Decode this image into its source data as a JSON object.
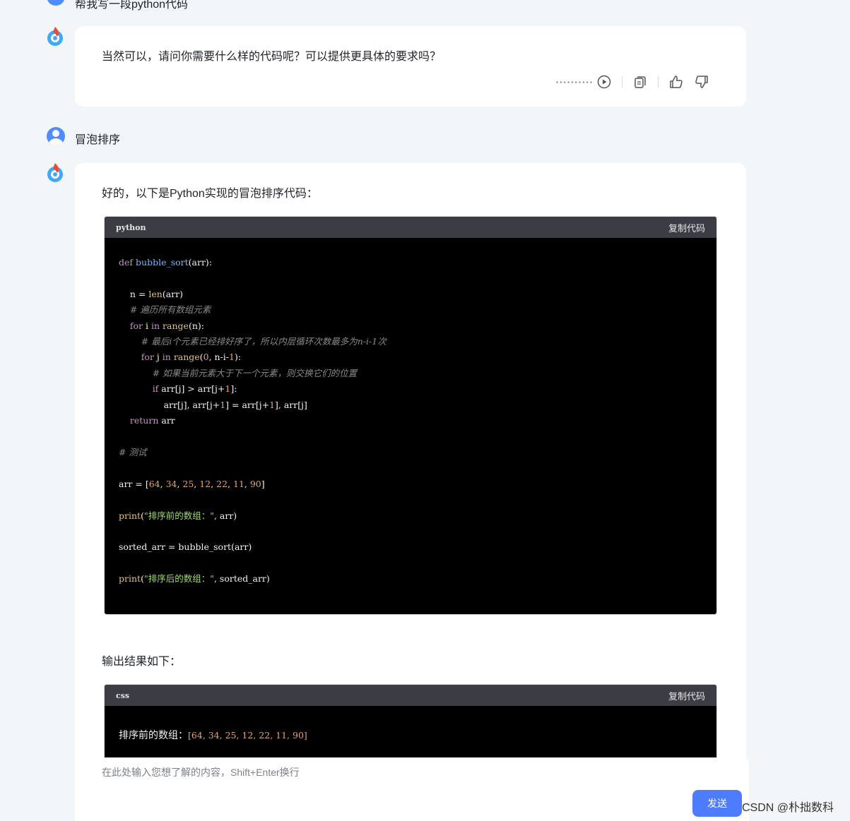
{
  "conversation": {
    "prev_user_message": "帮我写一段python代码",
    "reply1": {
      "text": "当然可以，请问你需要什么样的代码呢？可以提供更具体的要求吗？",
      "dots": "··········"
    },
    "user_message": "冒泡排序",
    "reply2": {
      "intro": "好的，以下是Python实现的冒泡排序代码：",
      "code1": {
        "lang": "python",
        "copy_label": "复制代码"
      },
      "output_intro": "输出结果如下：",
      "code2": {
        "lang": "css",
        "copy_label": "复制代码",
        "line1_text": "排序前的数组：",
        "line1_value": "[64, 34, 25, 12, 22, 11, 90]"
      }
    }
  },
  "code_lines": {
    "def": "def",
    "fname": "bubble_sort",
    "args": "(arr):",
    "n_assign": "n = ",
    "len": "len",
    "len_args": "(arr)",
    "c1": "# 遍历所有数组元素",
    "for1": "for",
    "for1_mid": " i ",
    "in1": "in",
    "range1": "range",
    "range1_args": "(n):",
    "c2": "# 最后i个元素已经排好序了，所以内层循环次数最多为n-i-1次",
    "for2": "for",
    "for2_mid": " j ",
    "in2": "in",
    "range2": "range",
    "range2_open": "(",
    "zero": "0",
    "range2_rest": ", n-i-",
    "one_a": "1",
    "range2_close": "):",
    "c3": "# 如果当前元素大于下一个元素，则交换它们的位置",
    "if": "if",
    "if_a": " arr[j] > arr[j+",
    "one_b": "1",
    "if_b": "]:",
    "swap_a": "arr[j], arr[j+",
    "one_c": "1",
    "swap_b": "] = arr[j+",
    "one_d": "1",
    "swap_c": "], arr[j]",
    "return": "return",
    "return_v": " arr",
    "c4": "# 测试",
    "arr_assign": "arr = [",
    "v1": "64",
    "v2": "34",
    "v3": "25",
    "v4": "12",
    "v5": "22",
    "v6": "11",
    "v7": "90",
    "comma": ", ",
    "arr_close": "]",
    "print1": "print",
    "print1_open": "(",
    "str1": "\"排序前的数组：\"",
    "print1_rest": ", arr)",
    "sorted_line_a": "sorted_arr = ",
    "sorted_fn": "bubble_sort",
    "sorted_line_b": "(arr)",
    "print2": "print",
    "print2_open": "(",
    "str2": "\"排序后的数组：\"",
    "print2_rest": ", sorted_arr)"
  },
  "input": {
    "placeholder": "在此处输入您想了解的内容，Shift+Enter换行",
    "send_label": "发送"
  },
  "credit": "CSDN @朴拙数科",
  "colors": {
    "accent": "#4e7cff",
    "code_bg": "#000000",
    "code_head": "#3c3c45"
  },
  "icons": [
    "play-icon",
    "copy-icon",
    "thumbs-up-icon",
    "thumbs-down-icon"
  ]
}
